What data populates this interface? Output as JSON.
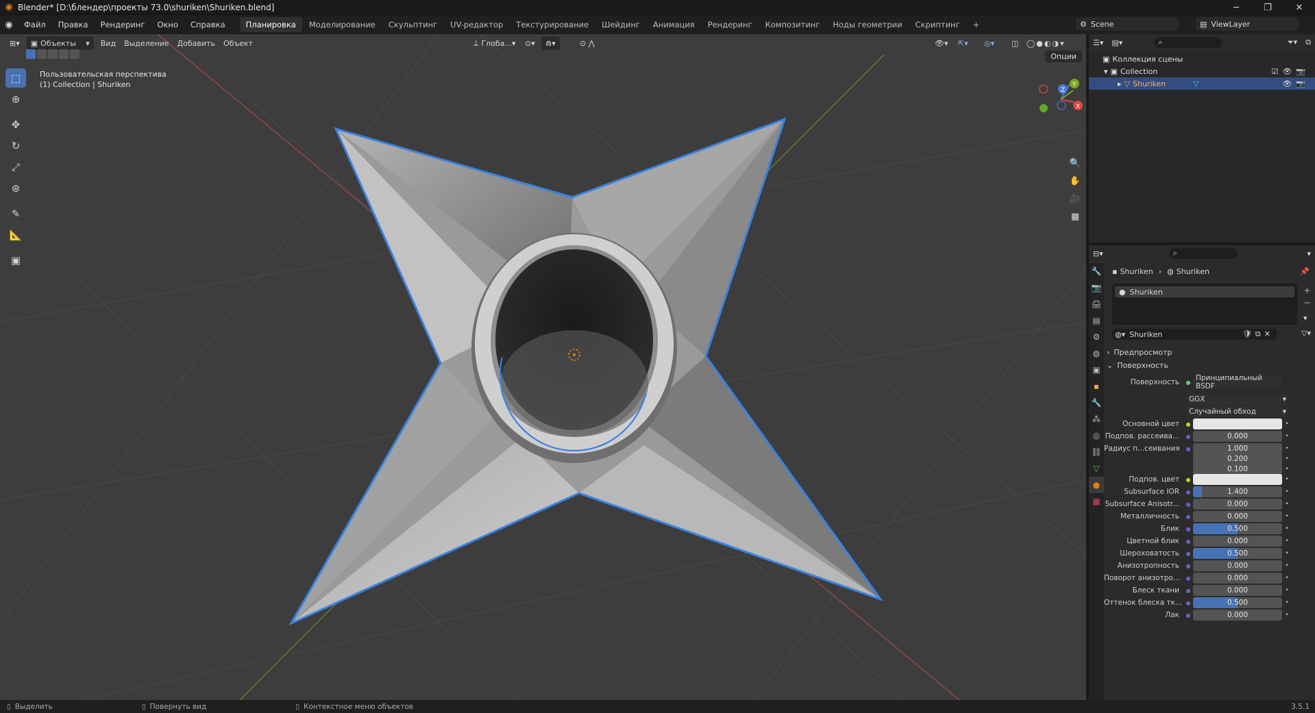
{
  "window": {
    "title": "Blender* [D:\\блендер\\проекты 73.0\\shuriken\\Shuriken.blend]",
    "minimize": "─",
    "maximize": "❐",
    "close": "✕"
  },
  "menu": [
    "Файл",
    "Правка",
    "Рендеринг",
    "Окно",
    "Справка"
  ],
  "workspaces": [
    "Планировка",
    "Моделирование",
    "Скульптинг",
    "UV-редактор",
    "Текстурирование",
    "Шейдинг",
    "Анимация",
    "Рендеринг",
    "Композитинг",
    "Ноды геометрии",
    "Скриптинг",
    "+"
  ],
  "active_workspace_index": 0,
  "scene": "Scene",
  "view_layer": "ViewLayer",
  "viewport": {
    "mode": "Объекты",
    "menus": [
      "Вид",
      "Выделение",
      "Добавить",
      "Объект"
    ],
    "transform_orientation": "Глоба...",
    "options": "Опции",
    "info_line1": "Пользовательская перспектива",
    "info_line2": "(1) Collection | Shuriken"
  },
  "outliner": {
    "scene_collection": "Коллекция сцены",
    "collection": "Collection",
    "object": "Shuriken"
  },
  "properties": {
    "breadcrumb_object": "Shuriken",
    "breadcrumb_material": "Shuriken",
    "slot_name": "Shuriken",
    "material_name": "Shuriken",
    "section_preview": "Предпросмотр",
    "section_surface": "Поверхность",
    "surface_label": "Поверхность",
    "surface_value": "Принципиальный BSDF",
    "distribution": "GGX",
    "subsurface_method": "Случайный обход",
    "rows": [
      {
        "label": "Основной цвет",
        "type": "color",
        "value": ""
      },
      {
        "label": "Подпов. рассеива...",
        "type": "num",
        "value": "0.000",
        "fill": 0
      },
      {
        "label": "Радиус п...сеивания",
        "type": "num",
        "value": "1.000",
        "fill": 0
      },
      {
        "label": "",
        "type": "num",
        "value": "0.200",
        "fill": 0
      },
      {
        "label": "",
        "type": "num",
        "value": "0.100",
        "fill": 0
      },
      {
        "label": "Подпов. цвет",
        "type": "color",
        "value": ""
      },
      {
        "label": "Subsurface IOR",
        "type": "num",
        "value": "1.400",
        "fill": 0.1
      },
      {
        "label": "Subsurface Anisotr...",
        "type": "num",
        "value": "0.000",
        "fill": 0
      },
      {
        "label": "Металличность",
        "type": "num",
        "value": "0.000",
        "fill": 0
      },
      {
        "label": "Блик",
        "type": "num",
        "value": "0.500",
        "fill": 0.5
      },
      {
        "label": "Цветной блик",
        "type": "num",
        "value": "0.000",
        "fill": 0
      },
      {
        "label": "Шероховатость",
        "type": "num",
        "value": "0.500",
        "fill": 0.5
      },
      {
        "label": "Анизотропность",
        "type": "num",
        "value": "0.000",
        "fill": 0
      },
      {
        "label": "Поворот анизотро...",
        "type": "num",
        "value": "0.000",
        "fill": 0
      },
      {
        "label": "Блеск ткани",
        "type": "num",
        "value": "0.000",
        "fill": 0
      },
      {
        "label": "Оттенок блеска тк...",
        "type": "num",
        "value": "0.500",
        "fill": 0.5
      },
      {
        "label": "Лак",
        "type": "num",
        "value": "0.000",
        "fill": 0
      }
    ]
  },
  "status": {
    "select": "Выделить",
    "rotate": "Повернуть вид",
    "context": "Контекстное меню объектов",
    "version": "3.5.1"
  },
  "colors": {
    "accent": "#4772b3",
    "selection_outline": "#3b82e0",
    "viewport_bg": "#3d3d3d",
    "object_origin": "#e87d0d"
  }
}
